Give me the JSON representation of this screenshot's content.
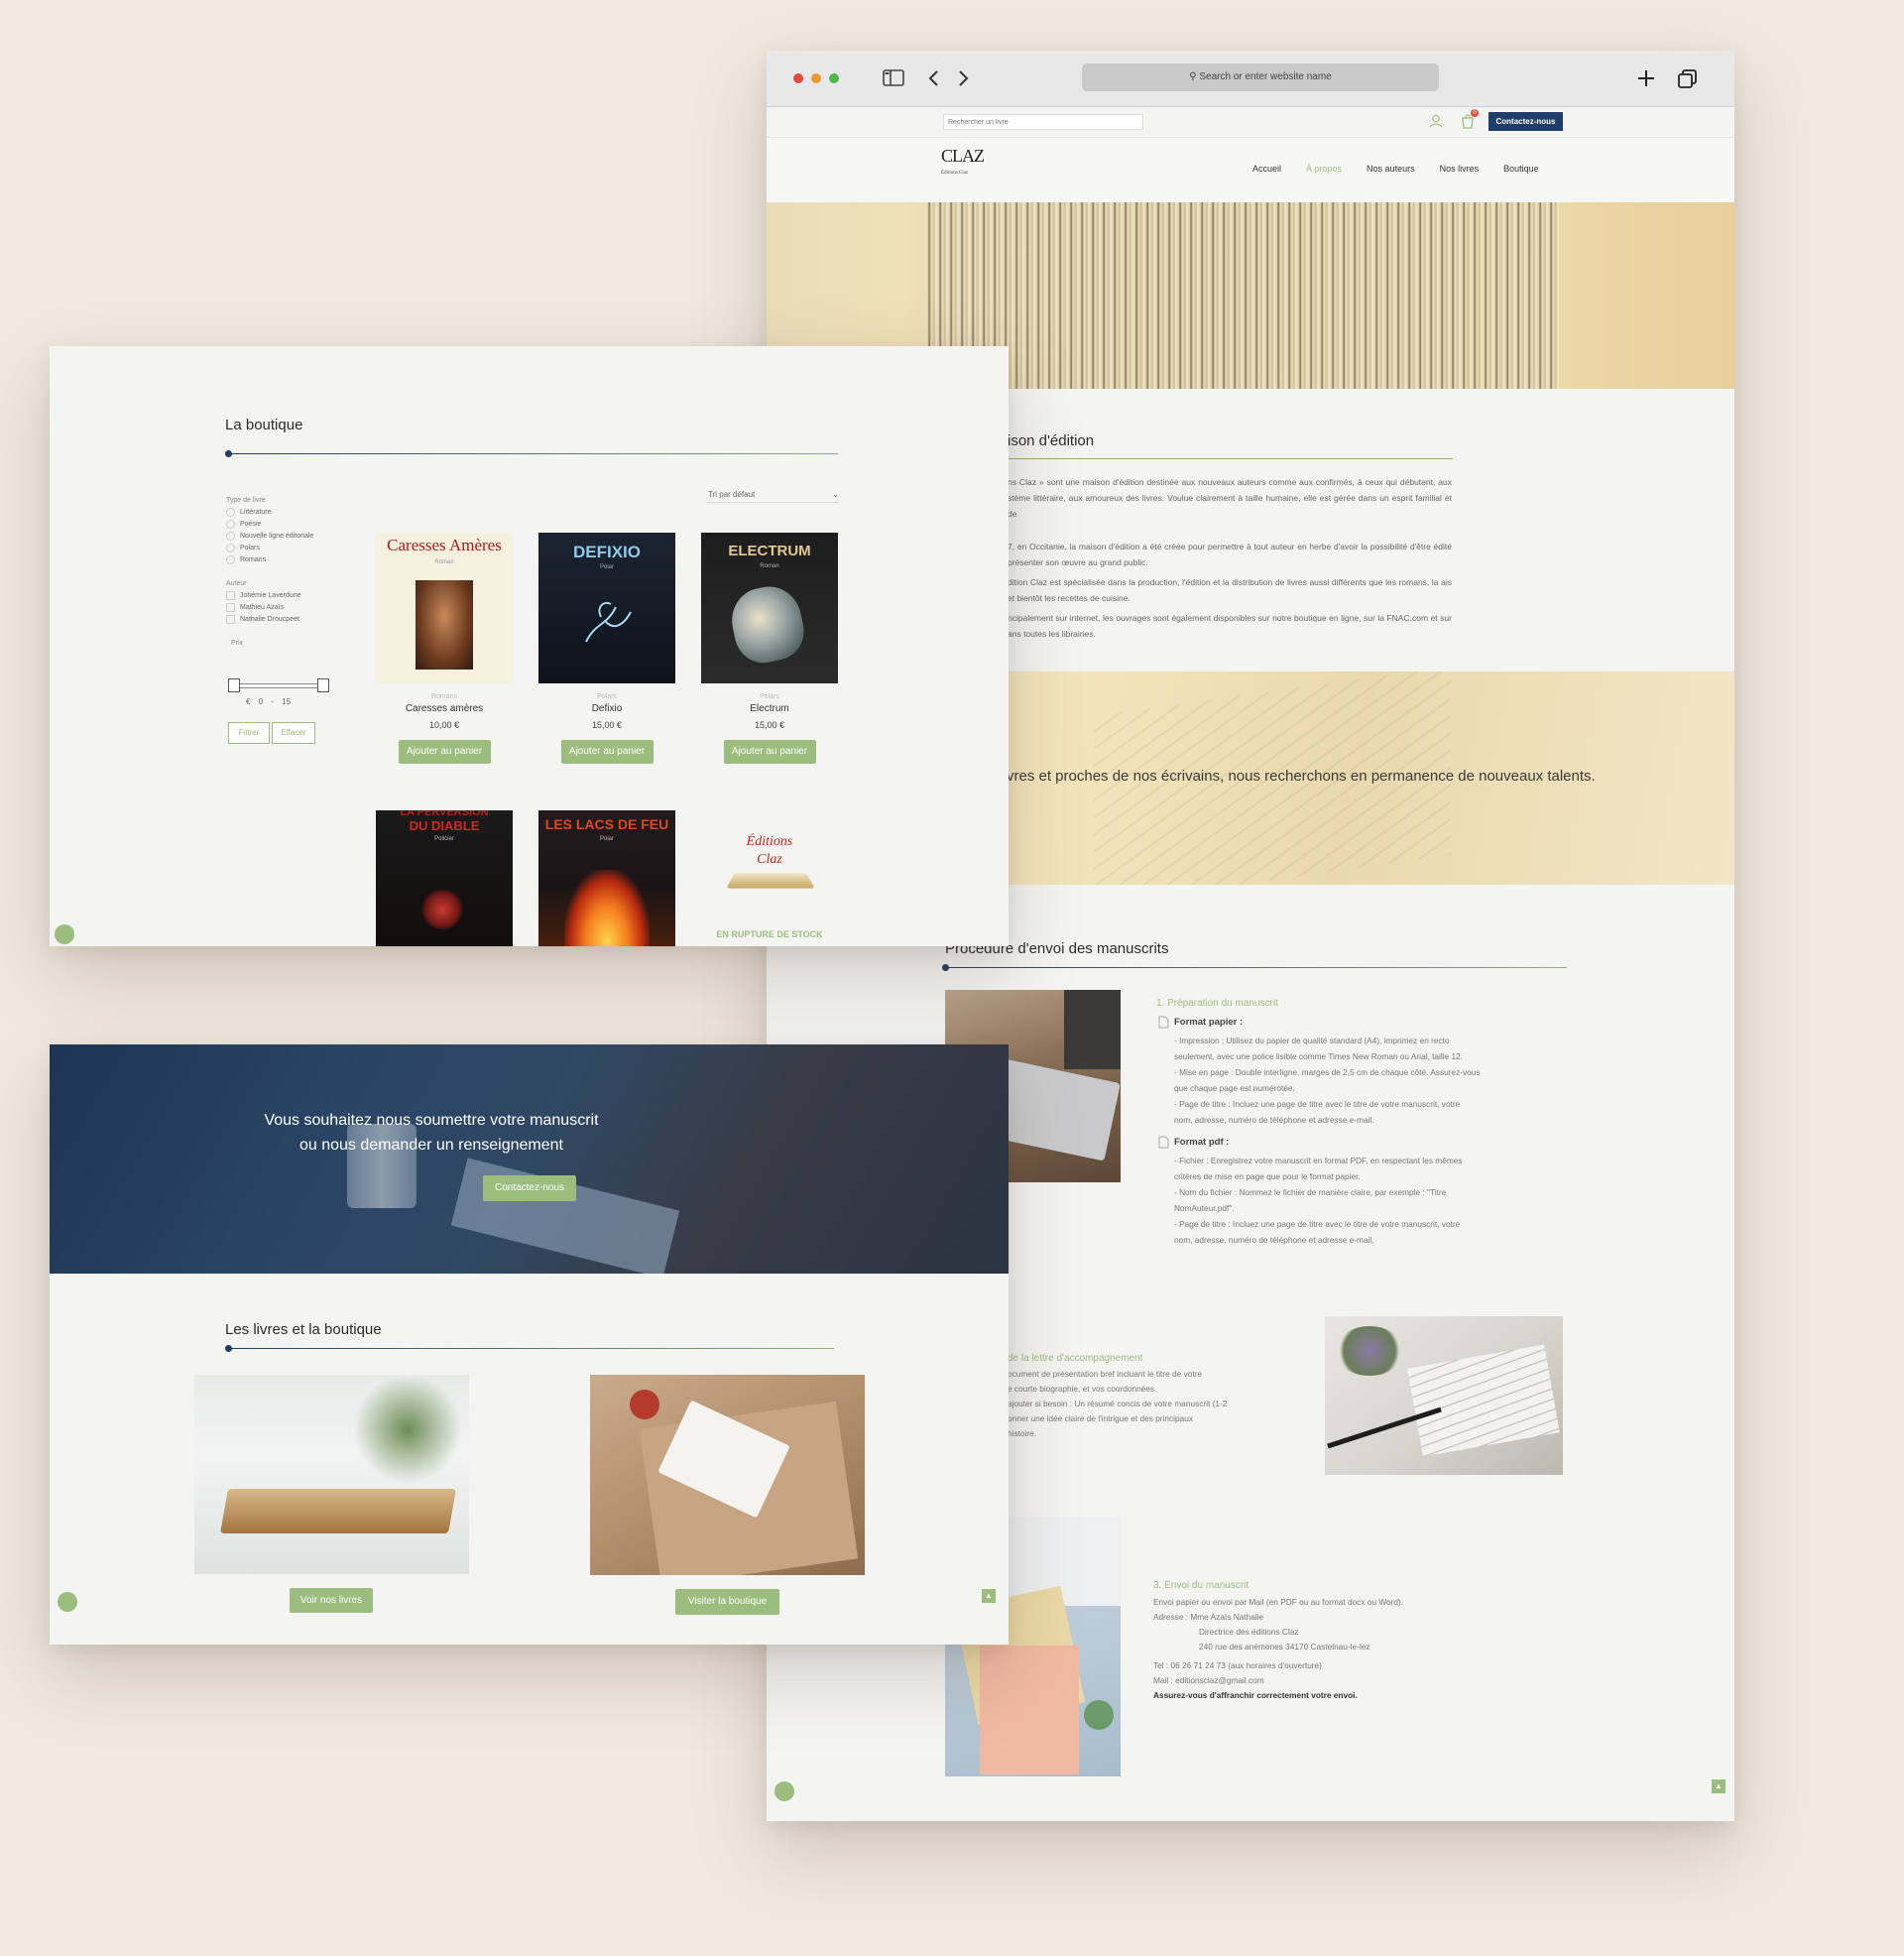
{
  "browser": {
    "address_placeholder": "Search or enter website name",
    "site_search_placeholder": "Rechercher un livre",
    "contact_button": "Contactez-nous",
    "cart_count": "0"
  },
  "site": {
    "logo_text": "CLAZ",
    "logo_subtitle": "Éditions Claz",
    "nav": [
      "Accueil",
      "À propos",
      "Nos auteurs",
      "Nos livres",
      "Boutique"
    ],
    "nav_active_index": 1
  },
  "about": {
    "heading": "ison d'édition",
    "paragraphs": [
      "ns Claz » sont une maison d'édition destinée aux nouveaux auteurs comme aux confirmés, à ceux qui débutent, aux stème littéraire, aux amoureux des livres. Voulue clairement à taille humaine, elle est gérée dans un esprit familial et de",
      "7, en Occitanie, la maison d'édition a été créée pour permettre à tout auteur en herbe d'avoir la possibilité d'être édité présenter son œuvre au grand public.",
      "dition Claz est spécialisée dans la production, l'édition et la distribution de livres aussi différents que les romans, la ais et bientôt les recettes de cuisine.",
      "ncipalement sur internet, les ouvrages sont également disponibles sur notre boutique en ligne, sur la FNAC.com et sur ans toutes les librairies."
    ],
    "banner_text": "vres et proches de nos écrivains, nous recherchons en permanence de nouveaux talents."
  },
  "procedure": {
    "heading": "Procédure d'envoi des manuscrits",
    "step1_title": "1. Préparation du manuscrit",
    "paper_title": "Format papier :",
    "paper_lines": [
      "- Impression : Utilisez du papier de qualité standard (A4), imprimez en recto",
      "seulement, avec une police lisible comme Times New Roman ou Arial, taille 12.",
      "- Mise en page : Double interligne, marges de 2,5 cm de chaque côté. Assurez-vous",
      "que chaque page est numérotée.",
      "- Page de titre : Incluez une page de titre avec le titre de votre manuscrit, votre",
      "nom, adresse, numéro de téléphone et adresse e-mail."
    ],
    "pdf_title": "Format pdf :",
    "pdf_lines": [
      "- Fichier : Enregistrez votre manuscrit en format PDF, en respectant les mêmes",
      "critères de mise en page que pour le format papier.",
      "- Nom du fichier : Nommez le fichier de manière claire, par exemple : \"Titre",
      "NomAuteur.pdf\".",
      "- Page de titre : Incluez une page de titre avec le titre de votre manuscrit, votre",
      "nom, adresse, numéro de téléphone et adresse e-mail."
    ],
    "step2_title": "de la lettre d'accompagnement",
    "step2_lines": [
      "ocument de présentation bref incluant le titre de votre",
      "e courte biographie, et vos coordonnées.",
      "ajouter si besoin : Un résumé concis de votre manuscrit (1-2",
      "onner une idée claire de l'intrigue et des principaux",
      "histoire."
    ],
    "step3_title": "3. Envoi du manuscrit",
    "step3_lines": [
      "Envoi papier ou envoi par Mail (en PDF ou au format docx ou Word).",
      "Adresse : Mme Azaïs Nathalie",
      "Directrice des éditions Claz",
      "240 rue des anémones     34170 Castelnau-le-lez",
      "Tel : 06 26 71 24 73   (aux horaires d'ouverture)",
      "Mail : editionsclaz@gmail.com",
      "Assurez-vous d'affranchir correctement votre envoi."
    ]
  },
  "shop": {
    "heading": "La boutique",
    "sort_label": "Tri par défaut",
    "filter_type_label": "Type de livre",
    "types": [
      "Littérature",
      "Poésie",
      "Nouvelle ligne éditoriale",
      "Polars",
      "Romans"
    ],
    "filter_author_label": "Auteur",
    "authors": [
      "Johémie Laverdune",
      "Mathieu Azaïs",
      "Nathalie Droucpeet"
    ],
    "price_label": "Prix",
    "price_currency": "€",
    "price_min": "0",
    "price_sep": "-",
    "price_max": "15",
    "filter_button": "Filtrer",
    "clear_button": "Effacer",
    "products": [
      {
        "cover_title": "Caresses Amères",
        "cover_sub": "Roman",
        "category": "Romans",
        "name": "Caresses amères",
        "price": "10,00 €",
        "button": "Ajouter au panier"
      },
      {
        "cover_title": "DEFIXIO",
        "cover_sub": "Polar",
        "category": "Polars",
        "name": "Defixio",
        "price": "15,00 €",
        "button": "Ajouter au panier"
      },
      {
        "cover_title": "ELECTRUM",
        "cover_sub": "Roman",
        "category": "Polars",
        "name": "Electrum",
        "price": "15,00 €",
        "button": "Ajouter au panier"
      }
    ],
    "row2": [
      {
        "cover_top": "LA PERVERSION",
        "cover_title": "DU DIABLE",
        "cover_sub": "Policier"
      },
      {
        "cover_title": "LES LACS DE FEU",
        "cover_sub": "Polar"
      },
      {
        "logo_line1": "Éditions",
        "logo_line2": "Claz",
        "badge": "EN RUPTURE DE STOCK"
      }
    ]
  },
  "home": {
    "hero_line1": "Vous souhaitez nous soumettre votre manuscrit",
    "hero_line2": "ou nous demander un renseignement",
    "hero_button": "Contactez-nous",
    "books_heading": "Les livres et la boutique",
    "books_button": "Voir nos livres",
    "shop_button": "Visiter la boutique"
  },
  "colors": {
    "accent_green": "#9bbd7e",
    "navy": "#1f3d6a",
    "background": "#f1e9df"
  }
}
